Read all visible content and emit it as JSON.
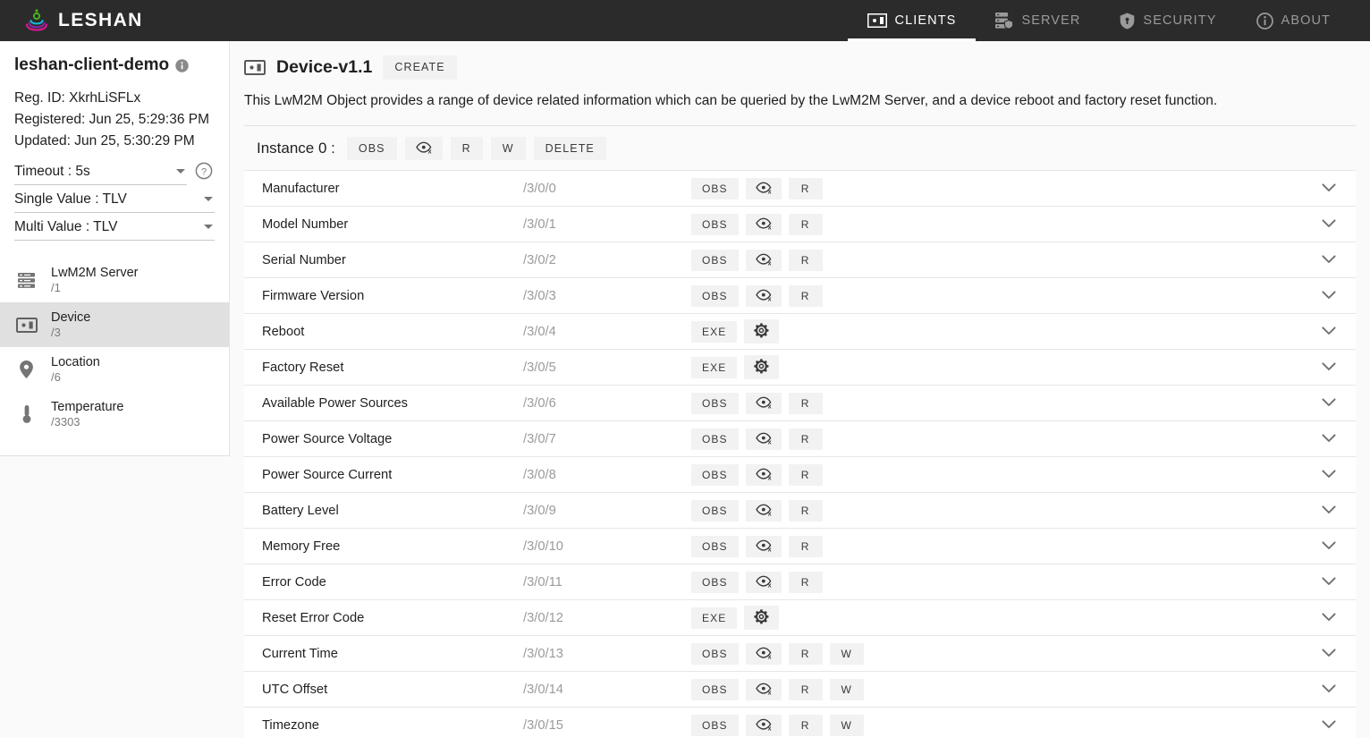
{
  "navbar": {
    "brand": "LESHAN",
    "brand_logo_icon": "leshan-logo-icon",
    "items": [
      {
        "label": "CLIENTS",
        "icon": "clients-device-icon",
        "active": true
      },
      {
        "label": "SERVER",
        "icon": "server-icon",
        "active": false
      },
      {
        "label": "SECURITY",
        "icon": "shield-lock-icon",
        "active": false
      },
      {
        "label": "ABOUT",
        "icon": "info-circle-icon",
        "active": false
      }
    ]
  },
  "sidebar": {
    "client_name": "leshan-client-demo",
    "info_icon": "info-icon",
    "reg_id": "Reg. ID: XkrhLiSFLx",
    "registered": "Registered: Jun 25, 5:29:36 PM",
    "updated": "Updated: Jun 25, 5:30:29 PM",
    "timeout_select": "Timeout : 5s",
    "help_icon": "help-circle-icon",
    "single_value_select": "Single Value : TLV",
    "multi_value_select": "Multi Value : TLV",
    "objects": [
      {
        "name": "LwM2M Server",
        "path": "/1",
        "icon": "server-rack-icon",
        "selected": false
      },
      {
        "name": "Device",
        "path": "/3",
        "icon": "device-icon",
        "selected": true
      },
      {
        "name": "Location",
        "path": "/6",
        "icon": "map-pin-icon",
        "selected": false
      },
      {
        "name": "Temperature",
        "path": "/3303",
        "icon": "thermometer-icon",
        "selected": false
      }
    ]
  },
  "main": {
    "object_icon": "device-icon",
    "object_title": "Device-v1.1",
    "create_label": "CREATE",
    "description": "This LwM2M Object provides a range of device related information which can be queried by the LwM2M Server, and a device reboot and factory reset function.",
    "instance_label": "Instance 0 :",
    "instance_ops": [
      {
        "label": "OBS",
        "kind": "text"
      },
      {
        "label": "",
        "kind": "icon",
        "icon": "eye-off-icon"
      },
      {
        "label": "R",
        "kind": "text"
      },
      {
        "label": "W",
        "kind": "text"
      },
      {
        "label": "DELETE",
        "kind": "text"
      }
    ],
    "resources": [
      {
        "name": "Manufacturer",
        "path": "/3/0/0",
        "ops": [
          "OBS",
          "eye-off-icon",
          "R"
        ]
      },
      {
        "name": "Model Number",
        "path": "/3/0/1",
        "ops": [
          "OBS",
          "eye-off-icon",
          "R"
        ]
      },
      {
        "name": "Serial Number",
        "path": "/3/0/2",
        "ops": [
          "OBS",
          "eye-off-icon",
          "R"
        ]
      },
      {
        "name": "Firmware Version",
        "path": "/3/0/3",
        "ops": [
          "OBS",
          "eye-off-icon",
          "R"
        ]
      },
      {
        "name": "Reboot",
        "path": "/3/0/4",
        "ops": [
          "EXE",
          "gear-icon"
        ]
      },
      {
        "name": "Factory Reset",
        "path": "/3/0/5",
        "ops": [
          "EXE",
          "gear-icon"
        ]
      },
      {
        "name": "Available Power Sources",
        "path": "/3/0/6",
        "ops": [
          "OBS",
          "eye-off-icon",
          "R"
        ]
      },
      {
        "name": "Power Source Voltage",
        "path": "/3/0/7",
        "ops": [
          "OBS",
          "eye-off-icon",
          "R"
        ]
      },
      {
        "name": "Power Source Current",
        "path": "/3/0/8",
        "ops": [
          "OBS",
          "eye-off-icon",
          "R"
        ]
      },
      {
        "name": "Battery Level",
        "path": "/3/0/9",
        "ops": [
          "OBS",
          "eye-off-icon",
          "R"
        ]
      },
      {
        "name": "Memory Free",
        "path": "/3/0/10",
        "ops": [
          "OBS",
          "eye-off-icon",
          "R"
        ]
      },
      {
        "name": "Error Code",
        "path": "/3/0/11",
        "ops": [
          "OBS",
          "eye-off-icon",
          "R"
        ]
      },
      {
        "name": "Reset Error Code",
        "path": "/3/0/12",
        "ops": [
          "EXE",
          "gear-icon"
        ]
      },
      {
        "name": "Current Time",
        "path": "/3/0/13",
        "ops": [
          "OBS",
          "eye-off-icon",
          "R",
          "W"
        ]
      },
      {
        "name": "UTC Offset",
        "path": "/3/0/14",
        "ops": [
          "OBS",
          "eye-off-icon",
          "R",
          "W"
        ]
      },
      {
        "name": "Timezone",
        "path": "/3/0/15",
        "ops": [
          "OBS",
          "eye-off-icon",
          "R",
          "W"
        ]
      }
    ],
    "row_expand_icon": "chevron-down-icon"
  },
  "colors": {
    "navbar_bg": "#2b2b2b",
    "page_bg": "#fafafa",
    "row_bg": "#ffffff",
    "selected_item_bg": "#e0e0e0",
    "button_bg": "#f2f2f2",
    "muted_text": "#9b9b9b",
    "logo_green": "#4caf1f",
    "logo_cyan": "#16b6d4",
    "logo_purple": "#8e24aa",
    "logo_magenta": "#d81b8c"
  }
}
